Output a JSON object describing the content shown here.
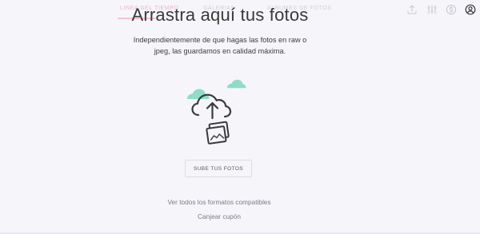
{
  "nav": {
    "tabs": [
      {
        "label": "LINEA DEL TIEMPO",
        "active": true
      },
      {
        "label": "GALERIAS",
        "active": false
      },
      {
        "label": "ALBUMES DE FOTOS",
        "active": false
      }
    ],
    "icons": [
      "upload-icon",
      "sliders-icon",
      "dollar-icon",
      "user-icon"
    ]
  },
  "main": {
    "title": "Arrastra aquí tus fotos",
    "description": "Independientemente de que hagas las fotos en raw o jpeg, las guardamos en calidad máxima.",
    "upload_button": "SUBE TUS FOTOS",
    "formats_link": "Ver todos los formatos compatibles",
    "coupon_link": "Canjear cupón"
  },
  "colors": {
    "background": "#f6f5fa",
    "accent_pink": "#f4c3cf",
    "cloud_mint": "#8fdcc9",
    "text_dark": "#3a3a3a",
    "link_gray": "#7c7c84"
  }
}
